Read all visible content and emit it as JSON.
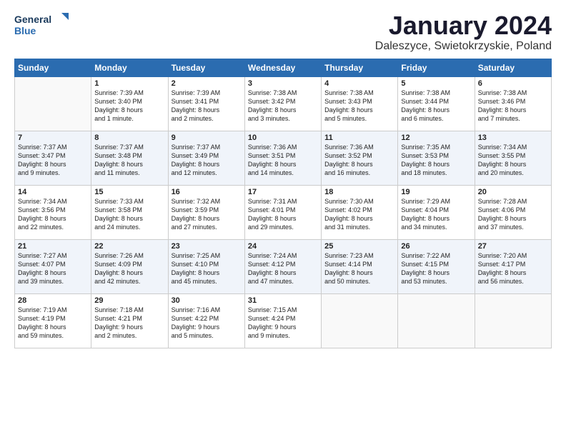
{
  "logo": {
    "line1": "General",
    "line2": "Blue"
  },
  "title": "January 2024",
  "location": "Daleszyce, Swietokrzyskie, Poland",
  "header": {
    "days": [
      "Sunday",
      "Monday",
      "Tuesday",
      "Wednesday",
      "Thursday",
      "Friday",
      "Saturday"
    ]
  },
  "weeks": [
    [
      {
        "day": "",
        "content": ""
      },
      {
        "day": "1",
        "content": "Sunrise: 7:39 AM\nSunset: 3:40 PM\nDaylight: 8 hours\nand 1 minute."
      },
      {
        "day": "2",
        "content": "Sunrise: 7:39 AM\nSunset: 3:41 PM\nDaylight: 8 hours\nand 2 minutes."
      },
      {
        "day": "3",
        "content": "Sunrise: 7:38 AM\nSunset: 3:42 PM\nDaylight: 8 hours\nand 3 minutes."
      },
      {
        "day": "4",
        "content": "Sunrise: 7:38 AM\nSunset: 3:43 PM\nDaylight: 8 hours\nand 5 minutes."
      },
      {
        "day": "5",
        "content": "Sunrise: 7:38 AM\nSunset: 3:44 PM\nDaylight: 8 hours\nand 6 minutes."
      },
      {
        "day": "6",
        "content": "Sunrise: 7:38 AM\nSunset: 3:46 PM\nDaylight: 8 hours\nand 7 minutes."
      }
    ],
    [
      {
        "day": "7",
        "content": "Sunrise: 7:37 AM\nSunset: 3:47 PM\nDaylight: 8 hours\nand 9 minutes."
      },
      {
        "day": "8",
        "content": "Sunrise: 7:37 AM\nSunset: 3:48 PM\nDaylight: 8 hours\nand 11 minutes."
      },
      {
        "day": "9",
        "content": "Sunrise: 7:37 AM\nSunset: 3:49 PM\nDaylight: 8 hours\nand 12 minutes."
      },
      {
        "day": "10",
        "content": "Sunrise: 7:36 AM\nSunset: 3:51 PM\nDaylight: 8 hours\nand 14 minutes."
      },
      {
        "day": "11",
        "content": "Sunrise: 7:36 AM\nSunset: 3:52 PM\nDaylight: 8 hours\nand 16 minutes."
      },
      {
        "day": "12",
        "content": "Sunrise: 7:35 AM\nSunset: 3:53 PM\nDaylight: 8 hours\nand 18 minutes."
      },
      {
        "day": "13",
        "content": "Sunrise: 7:34 AM\nSunset: 3:55 PM\nDaylight: 8 hours\nand 20 minutes."
      }
    ],
    [
      {
        "day": "14",
        "content": "Sunrise: 7:34 AM\nSunset: 3:56 PM\nDaylight: 8 hours\nand 22 minutes."
      },
      {
        "day": "15",
        "content": "Sunrise: 7:33 AM\nSunset: 3:58 PM\nDaylight: 8 hours\nand 24 minutes."
      },
      {
        "day": "16",
        "content": "Sunrise: 7:32 AM\nSunset: 3:59 PM\nDaylight: 8 hours\nand 27 minutes."
      },
      {
        "day": "17",
        "content": "Sunrise: 7:31 AM\nSunset: 4:01 PM\nDaylight: 8 hours\nand 29 minutes."
      },
      {
        "day": "18",
        "content": "Sunrise: 7:30 AM\nSunset: 4:02 PM\nDaylight: 8 hours\nand 31 minutes."
      },
      {
        "day": "19",
        "content": "Sunrise: 7:29 AM\nSunset: 4:04 PM\nDaylight: 8 hours\nand 34 minutes."
      },
      {
        "day": "20",
        "content": "Sunrise: 7:28 AM\nSunset: 4:06 PM\nDaylight: 8 hours\nand 37 minutes."
      }
    ],
    [
      {
        "day": "21",
        "content": "Sunrise: 7:27 AM\nSunset: 4:07 PM\nDaylight: 8 hours\nand 39 minutes."
      },
      {
        "day": "22",
        "content": "Sunrise: 7:26 AM\nSunset: 4:09 PM\nDaylight: 8 hours\nand 42 minutes."
      },
      {
        "day": "23",
        "content": "Sunrise: 7:25 AM\nSunset: 4:10 PM\nDaylight: 8 hours\nand 45 minutes."
      },
      {
        "day": "24",
        "content": "Sunrise: 7:24 AM\nSunset: 4:12 PM\nDaylight: 8 hours\nand 47 minutes."
      },
      {
        "day": "25",
        "content": "Sunrise: 7:23 AM\nSunset: 4:14 PM\nDaylight: 8 hours\nand 50 minutes."
      },
      {
        "day": "26",
        "content": "Sunrise: 7:22 AM\nSunset: 4:15 PM\nDaylight: 8 hours\nand 53 minutes."
      },
      {
        "day": "27",
        "content": "Sunrise: 7:20 AM\nSunset: 4:17 PM\nDaylight: 8 hours\nand 56 minutes."
      }
    ],
    [
      {
        "day": "28",
        "content": "Sunrise: 7:19 AM\nSunset: 4:19 PM\nDaylight: 8 hours\nand 59 minutes."
      },
      {
        "day": "29",
        "content": "Sunrise: 7:18 AM\nSunset: 4:21 PM\nDaylight: 9 hours\nand 2 minutes."
      },
      {
        "day": "30",
        "content": "Sunrise: 7:16 AM\nSunset: 4:22 PM\nDaylight: 9 hours\nand 5 minutes."
      },
      {
        "day": "31",
        "content": "Sunrise: 7:15 AM\nSunset: 4:24 PM\nDaylight: 9 hours\nand 9 minutes."
      },
      {
        "day": "",
        "content": ""
      },
      {
        "day": "",
        "content": ""
      },
      {
        "day": "",
        "content": ""
      }
    ]
  ]
}
